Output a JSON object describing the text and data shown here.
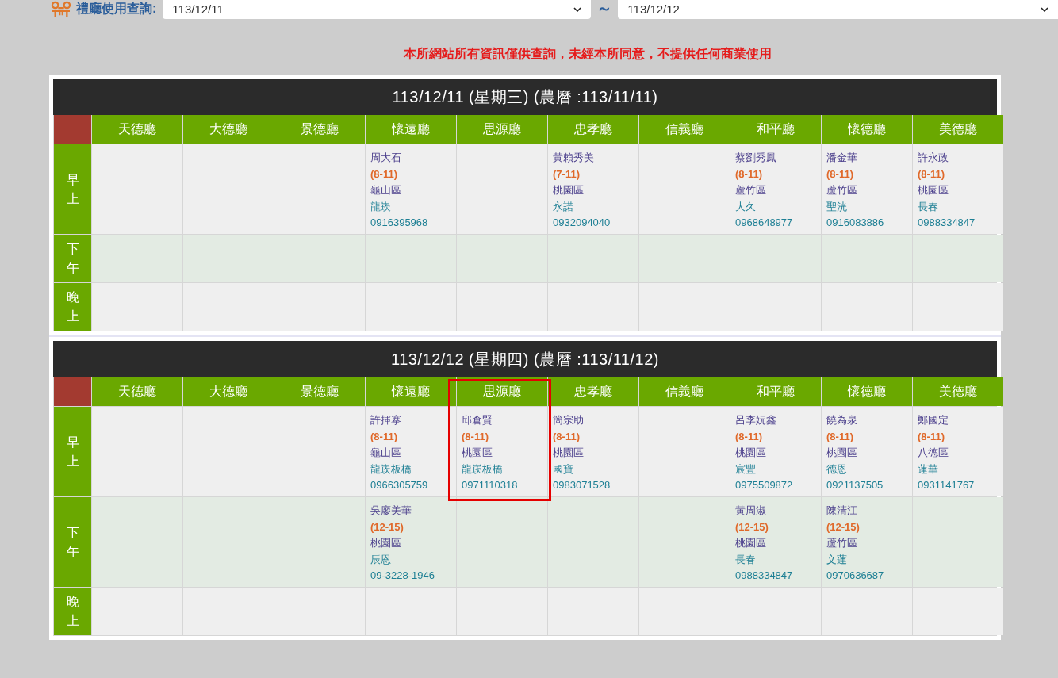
{
  "query": {
    "label": "禮廳使用查詢:",
    "from": "113/12/11",
    "separator": "～",
    "to": "113/12/12"
  },
  "notice": "本所網站所有資訊僅供查詢，未經本所同意，不提供任何商業使用",
  "days": [
    {
      "title": "113/12/11 (星期三) (農曆 :113/11/11)",
      "halls": [
        {
          "name": "天德廳",
          "highlighted": false
        },
        {
          "name": "大德廳",
          "highlighted": false
        },
        {
          "name": "景德廳",
          "highlighted": false
        },
        {
          "name": "懷遠廳",
          "highlighted": false
        },
        {
          "name": "思源廳",
          "highlighted": false
        },
        {
          "name": "忠孝廳",
          "highlighted": false
        },
        {
          "name": "信義廳",
          "highlighted": false
        },
        {
          "name": "和平廳",
          "highlighted": false
        },
        {
          "name": "懷德廳",
          "highlighted": false
        },
        {
          "name": "美德廳",
          "highlighted": false
        }
      ],
      "periods": [
        {
          "label": "早上",
          "cells": [
            null,
            null,
            null,
            {
              "name": "周大石",
              "time": "(8-11)",
              "district": "龜山區",
              "place": "龍崁",
              "phone": "0916395968"
            },
            null,
            {
              "name": "黃賴秀美",
              "time": "(7-11)",
              "district": "桃園區",
              "place": "永諾",
              "phone": "0932094040"
            },
            null,
            {
              "name": "蔡劉秀鳳",
              "time": "(8-11)",
              "district": "蘆竹區",
              "place": "大久",
              "phone": "0968648977"
            },
            {
              "name": "潘金華",
              "time": "(8-11)",
              "district": "蘆竹區",
              "place": "聖洸",
              "phone": "0916083886"
            },
            {
              "name": "許永政",
              "time": "(8-11)",
              "district": "桃園區",
              "place": "長春",
              "phone": "0988334847"
            }
          ]
        },
        {
          "label": "下午",
          "cells": [
            null,
            null,
            null,
            null,
            null,
            null,
            null,
            null,
            null,
            null
          ]
        },
        {
          "label": "晚上",
          "cells": [
            null,
            null,
            null,
            null,
            null,
            null,
            null,
            null,
            null,
            null
          ]
        }
      ]
    },
    {
      "title": "113/12/12 (星期四) (農曆 :113/11/12)",
      "halls": [
        {
          "name": "天德廳",
          "highlighted": false
        },
        {
          "name": "大德廳",
          "highlighted": false
        },
        {
          "name": "景德廳",
          "highlighted": false
        },
        {
          "name": "懷遠廳",
          "highlighted": false
        },
        {
          "name": "思源廳",
          "highlighted": true
        },
        {
          "name": "忠孝廳",
          "highlighted": false
        },
        {
          "name": "信義廳",
          "highlighted": false
        },
        {
          "name": "和平廳",
          "highlighted": false
        },
        {
          "name": "懷德廳",
          "highlighted": false
        },
        {
          "name": "美德廳",
          "highlighted": false
        }
      ],
      "periods": [
        {
          "label": "早上",
          "cells": [
            null,
            null,
            null,
            {
              "name": "許揮搴",
              "time": "(8-11)",
              "district": "龜山區",
              "place": "龍崁板橋",
              "phone": "0966305759"
            },
            {
              "name": "邱倉賢",
              "time": "(8-11)",
              "district": "桃園區",
              "place": "龍崁板橋",
              "phone": "0971110318"
            },
            {
              "name": "簡宗助",
              "time": "(8-11)",
              "district": "桃園區",
              "place": "國寶",
              "phone": "0983071528"
            },
            null,
            {
              "name": "呂李妧鑫",
              "time": "(8-11)",
              "district": "桃園區",
              "place": "宸豐",
              "phone": "0975509872"
            },
            {
              "name": "饒為泉",
              "time": "(8-11)",
              "district": "桃園區",
              "place": "德恩",
              "phone": "0921137505"
            },
            {
              "name": "鄭國定",
              "time": "(8-11)",
              "district": "八德區",
              "place": "蓮華",
              "phone": "0931141767"
            }
          ]
        },
        {
          "label": "下午",
          "cells": [
            null,
            null,
            null,
            {
              "name": "吳廖美華",
              "time": "(12-15)",
              "district": "桃園區",
              "place": "辰恩",
              "phone": "09-3228-1946"
            },
            null,
            null,
            null,
            {
              "name": "黃周淑",
              "time": "(12-15)",
              "district": "桃園區",
              "place": "長春",
              "phone": "0988334847"
            },
            {
              "name": "陳清江",
              "time": "(12-15)",
              "district": "蘆竹區",
              "place": "文蓮",
              "phone": "0970636687"
            },
            null
          ]
        },
        {
          "label": "晚上",
          "cells": [
            null,
            null,
            null,
            null,
            null,
            null,
            null,
            null,
            null,
            null
          ]
        }
      ]
    }
  ]
}
